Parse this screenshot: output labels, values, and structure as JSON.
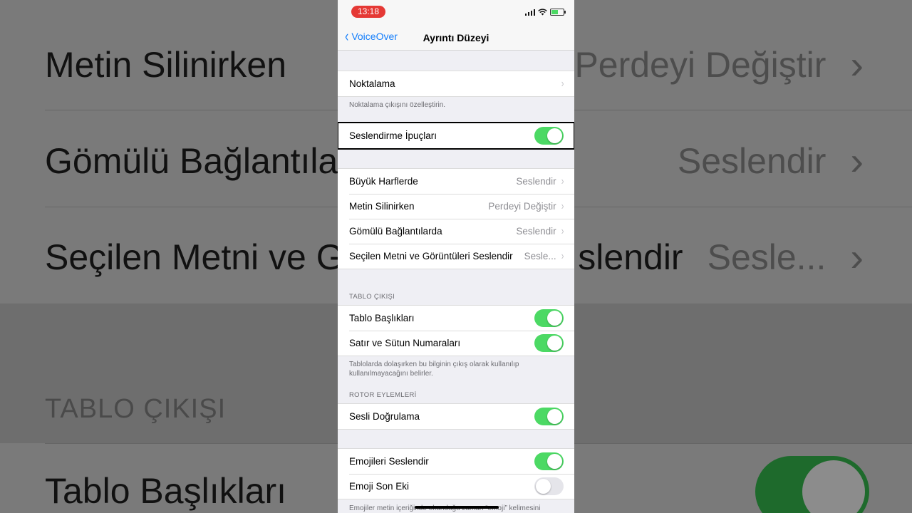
{
  "background": {
    "rows": [
      {
        "label": "Metin Silinirken",
        "value": "Perdeyi Değiştir"
      },
      {
        "label": "Gömülü Bağlantıla",
        "value": "Seslendir"
      },
      {
        "label": "Seçilen Metni ve G",
        "mid": "slendir",
        "value": "Sesle..."
      }
    ],
    "section_header": "TABLO ÇIKIŞI",
    "bottom_row": "Tablo Başlıkları"
  },
  "status": {
    "time": "13:18"
  },
  "nav": {
    "back_label": "VoiceOver",
    "title": "Ayrıntı Düzeyi"
  },
  "groups": {
    "punctuation": {
      "label": "Noktalama",
      "footer": "Noktalama çıkışını özelleştirin."
    },
    "hints": {
      "label": "Seslendirme İpuçları",
      "on": true
    },
    "speech": [
      {
        "label": "Büyük Harflerde",
        "value": "Seslendir"
      },
      {
        "label": "Metin Silinirken",
        "value": "Perdeyi Değiştir"
      },
      {
        "label": "Gömülü Bağlantılarda",
        "value": "Seslendir"
      },
      {
        "label": "Seçilen Metni ve Görüntüleri Seslendir",
        "value": "Sesle..."
      }
    ],
    "table_output": {
      "header": "TABLO ÇIKIŞI",
      "rows": [
        {
          "label": "Tablo Başlıkları",
          "on": true
        },
        {
          "label": "Satır ve Sütun Numaraları",
          "on": true
        }
      ],
      "footer": "Tablolarda dolaşırken bu bilginin çıkış olarak kullanılıp kullanılmayacağını belirler."
    },
    "rotor": {
      "header": "ROTOR EYLEMLERİ",
      "rows": [
        {
          "label": "Sesli Doğrulama",
          "on": true
        }
      ]
    },
    "emoji": {
      "rows": [
        {
          "label": "Emojileri Seslendir",
          "on": true
        },
        {
          "label": "Emoji Son Eki",
          "on": false
        }
      ],
      "footer": "Emojiler metin içeriğinde okunduğu zaman “emoji” kelimesini"
    }
  },
  "colors": {
    "accent": "#147efb",
    "switch_on": "#4cd964",
    "time_pill": "#e53935"
  }
}
